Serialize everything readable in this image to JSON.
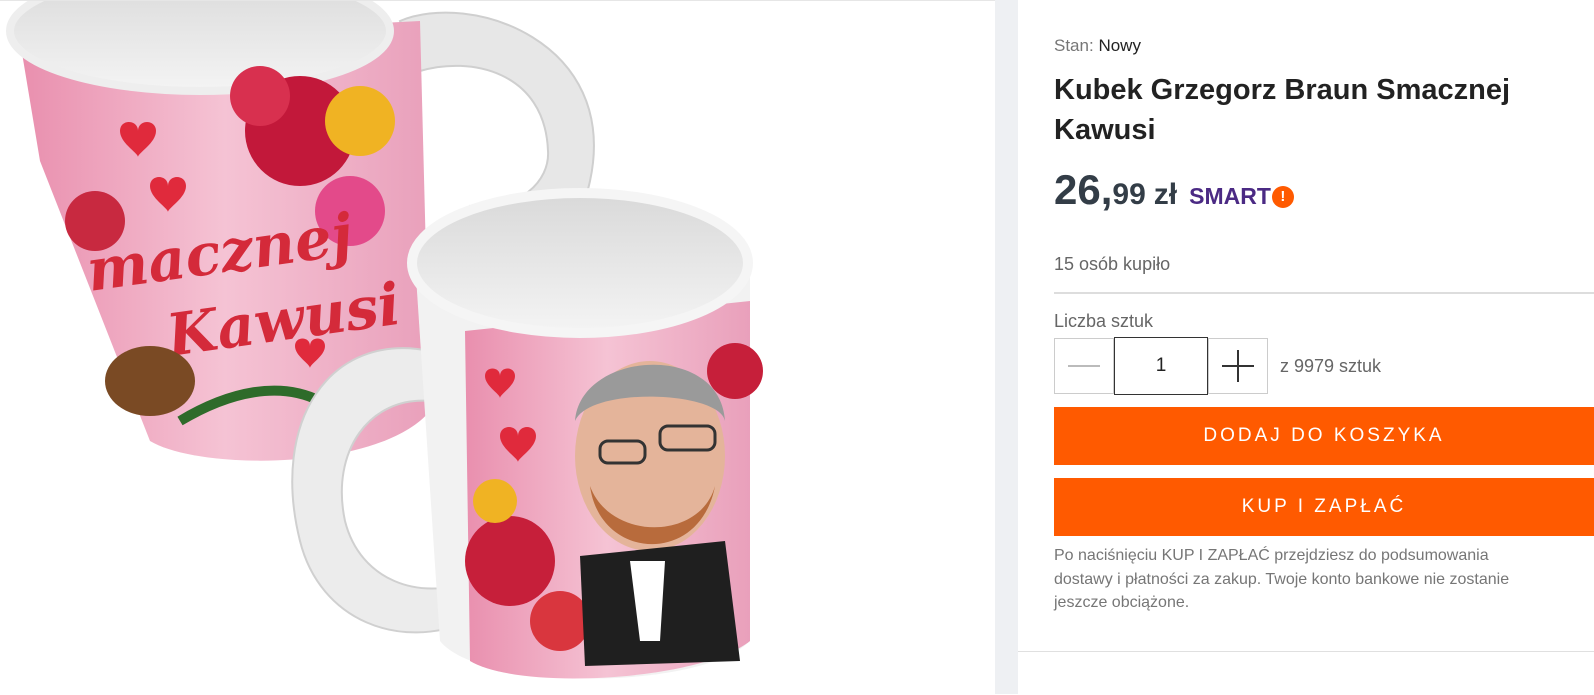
{
  "product": {
    "condition_label": "Stan:",
    "condition_value": "Nowy",
    "title": "Kubek Grzegorz Braun Smacznej Kawusi",
    "image_alt": "Kubek Grzegorz Braun Smacznej Kawusi",
    "mug_text_line1": "macznej",
    "mug_text_line2": "Kawusi"
  },
  "price": {
    "integer": "26,",
    "decimal": "99",
    "currency": "zł",
    "smart_label": "SMART",
    "smart_badge": "!"
  },
  "stats": {
    "bought": "15 osób kupiło"
  },
  "quantity": {
    "label": "Liczba sztuk",
    "value": "1",
    "available": "z 9979 sztuk"
  },
  "actions": {
    "add_to_cart": "DODAJ DO KOSZYKA",
    "buy_now": "KUP I ZAPŁAĆ"
  },
  "note": {
    "line1": "Po naciśnięciu KUP I ZAPŁAĆ przejdziesz do podsumowania",
    "line2": "dostawy i płatności za zakup. Twoje konto bankowe nie zostanie",
    "line3": "jeszcze obciążone."
  },
  "colors": {
    "accent": "#ff5a00",
    "smart": "#4b2a84",
    "price": "#333d47"
  }
}
